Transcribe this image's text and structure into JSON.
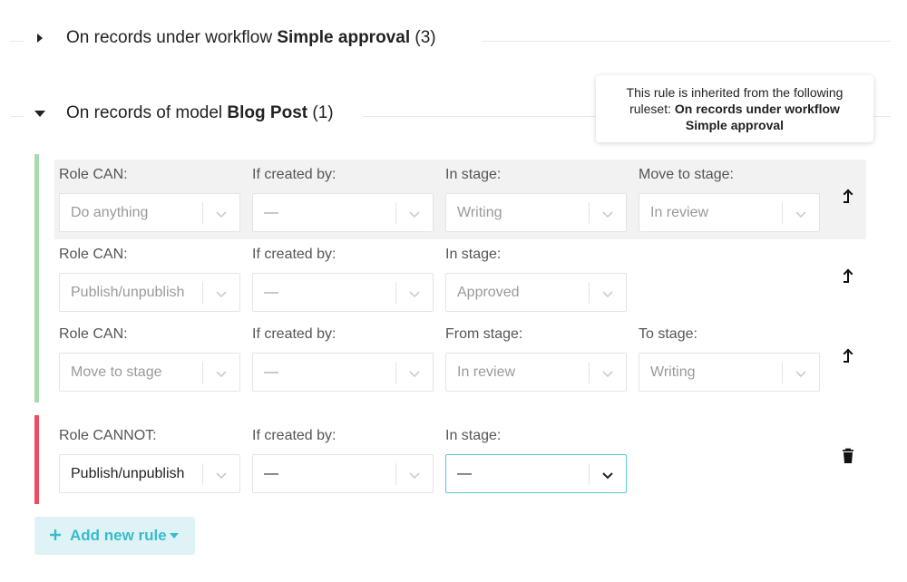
{
  "sections": [
    {
      "prefix": "On records under workflow",
      "name": "Simple approval",
      "count": "(3)",
      "expanded": false
    },
    {
      "prefix": "On records of model",
      "name": "Blog Post",
      "count": "(1)",
      "expanded": true
    }
  ],
  "tooltip": {
    "line1": "This rule is inherited from the following",
    "line2_prefix": "ruleset:",
    "line2_bold": "On records under workflow",
    "line3_bold": "Simple approval"
  },
  "inherited_rules": [
    {
      "fields": [
        {
          "label": "Role CAN:",
          "value": "Do anything"
        },
        {
          "label": "If created by:",
          "value": "—"
        },
        {
          "label": "In stage:",
          "value": "Writing"
        },
        {
          "label": "Move to stage:",
          "value": "In review"
        }
      ]
    },
    {
      "fields": [
        {
          "label": "Role CAN:",
          "value": "Publish/unpublish"
        },
        {
          "label": "If created by:",
          "value": "—"
        },
        {
          "label": "In stage:",
          "value": "Approved"
        }
      ]
    },
    {
      "fields": [
        {
          "label": "Role CAN:",
          "value": "Move to stage"
        },
        {
          "label": "If created by:",
          "value": "—"
        },
        {
          "label": "From stage:",
          "value": "In review"
        },
        {
          "label": "To stage:",
          "value": "Writing"
        }
      ]
    }
  ],
  "own_rule": {
    "fields": [
      {
        "label": "Role CANNOT:",
        "value": "Publish/unpublish"
      },
      {
        "label": "If created by:",
        "value": "—"
      },
      {
        "label": "In stage:",
        "value": "—"
      }
    ]
  },
  "add_button": {
    "label": "Add new rule"
  },
  "colors": {
    "inherited_bar": "#a6dcae",
    "own_bar": "#ee4d61",
    "accent": "#38bccb"
  },
  "icons": {
    "inherited_action": "arrow-up-icon",
    "own_action": "trash-icon"
  }
}
